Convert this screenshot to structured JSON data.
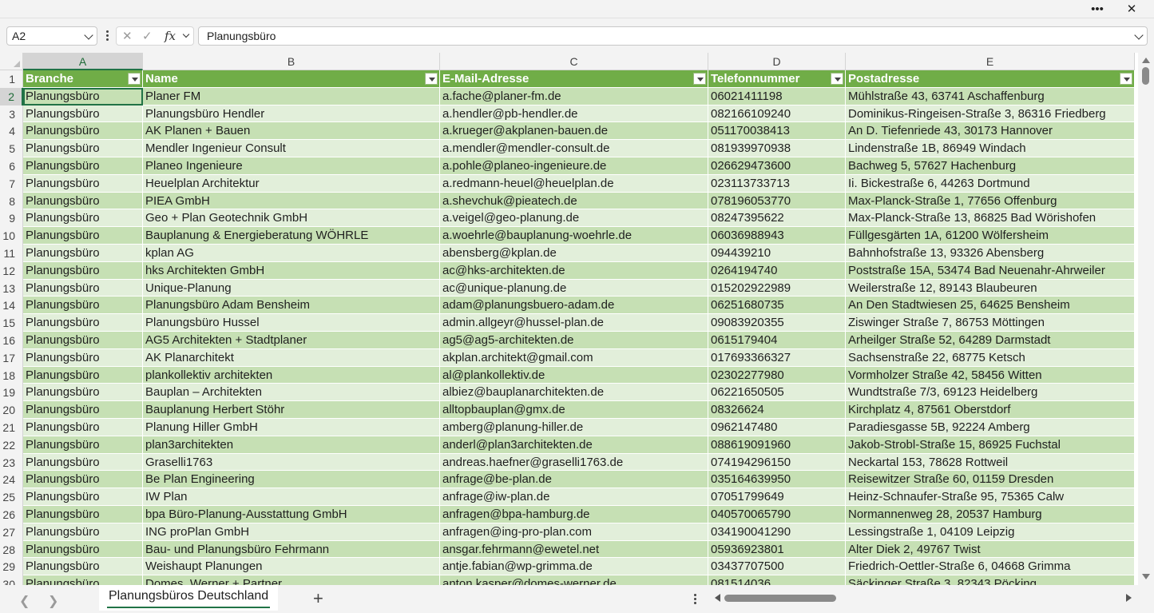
{
  "window": {
    "more_label": "•••",
    "close_label": "✕"
  },
  "formula_bar": {
    "name_box": "A2",
    "formula": "Planungsbüro",
    "cancel_icon": "✕",
    "enter_icon": "✓",
    "fx_label": "fx"
  },
  "columns": [
    "A",
    "B",
    "C",
    "D",
    "E"
  ],
  "selected_column": "A",
  "table": {
    "headers": [
      "Branche",
      "Name",
      "E-Mail-Adresse",
      "Telefonnummer",
      "Postadresse"
    ],
    "rows": [
      [
        "Planungsbüro",
        "Planer FM",
        "a.fache@planer-fm.de",
        "06021411198",
        "Mühlstraße 43, 63741 Aschaffenburg"
      ],
      [
        "Planungsbüro",
        "Planungsbüro Hendler",
        "a.hendler@pb-hendler.de",
        "082166109240",
        "Dominikus-Ringeisen-Straße 3, 86316 Friedberg"
      ],
      [
        "Planungsbüro",
        "AK Planen + Bauen",
        "a.krueger@akplanen-bauen.de",
        "051170038413",
        "An D. Tiefenriede 43, 30173 Hannover"
      ],
      [
        "Planungsbüro",
        "Mendler Ingenieur Consult",
        "a.mendler@mendler-consult.de",
        "081939970938",
        "Lindenstraße 1B, 86949 Windach"
      ],
      [
        "Planungsbüro",
        "Planeo Ingenieure",
        "a.pohle@planeo-ingenieure.de",
        "026629473600",
        "Bachweg 5, 57627 Hachenburg"
      ],
      [
        "Planungsbüro",
        "Heuelplan Architektur",
        "a.redmann-heuel@heuelplan.de",
        "023113733713",
        "Ii. Bickestraße 6, 44263 Dortmund"
      ],
      [
        "Planungsbüro",
        "PIEA GmbH",
        "a.shevchuk@pieatech.de",
        "078196053770",
        "Max-Planck-Straße 1, 77656 Offenburg"
      ],
      [
        "Planungsbüro",
        "Geo + Plan Geotechnik GmbH",
        "a.veigel@geo-planung.de",
        "08247395622",
        "Max-Planck-Straße 13, 86825 Bad Wörishofen"
      ],
      [
        "Planungsbüro",
        "Bauplanung & Energieberatung WÖHRLE",
        "a.woehrle@bauplanung-woehrle.de",
        "06036988943",
        "Füllgesgärten 1A, 61200 Wölfersheim"
      ],
      [
        "Planungsbüro",
        "kplan AG",
        "abensberg@kplan.de",
        "094439210",
        "Bahnhofstraße 13, 93326 Abensberg"
      ],
      [
        "Planungsbüro",
        "hks Architekten GmbH",
        "ac@hks-architekten.de",
        "0264194740",
        "Poststraße 15A, 53474 Bad Neuenahr-Ahrweiler"
      ],
      [
        "Planungsbüro",
        "Unique-Planung",
        "ac@unique-planung.de",
        "015202922989",
        "Weilerstraße 12, 89143 Blaubeuren"
      ],
      [
        "Planungsbüro",
        "Planungsbüro Adam Bensheim",
        "adam@planungsbuero-adam.de",
        "06251680735",
        "An Den Stadtwiesen 25, 64625 Bensheim"
      ],
      [
        "Planungsbüro",
        "Planungsbüro Hussel",
        "admin.allgeyr@hussel-plan.de",
        "09083920355",
        "Ziswinger Straße 7, 86753 Möttingen"
      ],
      [
        "Planungsbüro",
        "AG5 Architekten + Stadtplaner",
        "ag5@ag5-architekten.de",
        "0615179404",
        "Arheilger Straße 52, 64289 Darmstadt"
      ],
      [
        "Planungsbüro",
        "AK Planarchitekt",
        "akplan.architekt@gmail.com",
        "017693366327",
        "Sachsenstraße 22, 68775 Ketsch"
      ],
      [
        "Planungsbüro",
        "plankollektiv architekten",
        "al@plankollektiv.de",
        "02302277980",
        "Vormholzer Straße 42, 58456 Witten"
      ],
      [
        "Planungsbüro",
        "Bauplan – Architekten",
        "albiez@bauplanarchitekten.de",
        "06221650505",
        "Wundtstraße 7/3, 69123 Heidelberg"
      ],
      [
        "Planungsbüro",
        "Bauplanung Herbert Stöhr",
        "alltopbauplan@gmx.de",
        "08326624",
        "Kirchplatz 4, 87561 Oberstdorf"
      ],
      [
        "Planungsbüro",
        "Planung Hiller GmbH",
        "amberg@planung-hiller.de",
        "0962147480",
        "Paradiesgasse 5B, 92224 Amberg"
      ],
      [
        "Planungsbüro",
        "plan3architekten",
        "anderl@plan3architekten.de",
        "088619091960",
        "Jakob-Strobl-Straße 15, 86925 Fuchstal"
      ],
      [
        "Planungsbüro",
        "Graselli1763",
        "andreas.haefner@graselli1763.de",
        "074194296150",
        "Neckartal 153, 78628 Rottweil"
      ],
      [
        "Planungsbüro",
        "Be Plan Engineering",
        "anfrage@be-plan.de",
        "035164639950",
        "Reisewitzer Straße 60, 01159 Dresden"
      ],
      [
        "Planungsbüro",
        "IW Plan",
        "anfrage@iw-plan.de",
        "07051799649",
        "Heinz-Schnaufer-Straße 95, 75365 Calw"
      ],
      [
        "Planungsbüro",
        "bpa Büro-Planung-Ausstattung GmbH",
        "anfragen@bpa-hamburg.de",
        "040570065790",
        "Normannenweg 28, 20537 Hamburg"
      ],
      [
        "Planungsbüro",
        "ING proPlan GmbH",
        "anfragen@ing-pro-plan.com",
        "034190041290",
        "Lessingstraße 1, 04109 Leipzig"
      ],
      [
        "Planungsbüro",
        "Bau- und Planungsbüro Fehrmann",
        "ansgar.fehrmann@ewetel.net",
        "05936923801",
        "Alter Diek 2, 49767 Twist"
      ],
      [
        "Planungsbüro",
        "Weishaupt Planungen",
        "antje.fabian@wp-grimma.de",
        "03437707500",
        "Friedrich-Oettler-Straße 6, 04668 Grimma"
      ],
      [
        "Planungsbüro",
        "Domes, Werner + Partner",
        "anton.kasper@domes-werner.de",
        "081514036",
        "Säckinger Straße 3, 82343 Pöcking"
      ]
    ]
  },
  "sheet_tabs": [
    {
      "label": "Planungsbüros Deutschland",
      "active": true
    }
  ],
  "bottom": {
    "add_sheet_label": "+"
  }
}
